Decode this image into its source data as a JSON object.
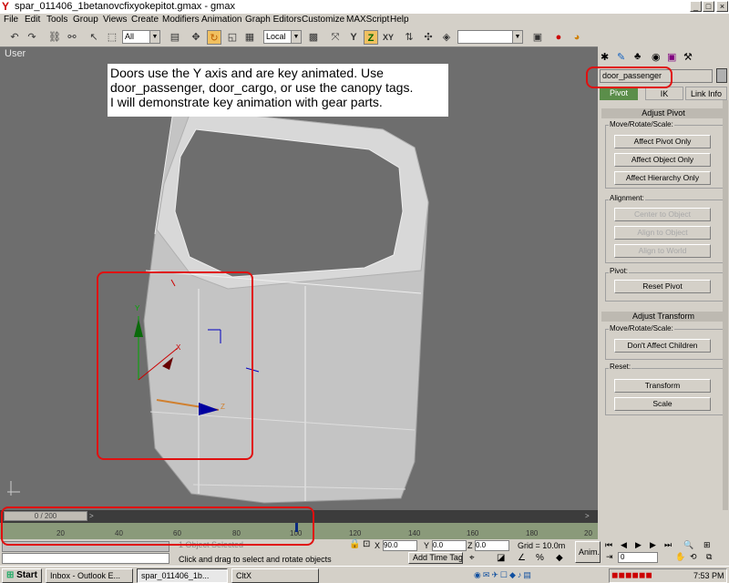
{
  "window": {
    "title": "spar_011406_1betanovcfixyokepitot.gmax - gmax",
    "min": "_",
    "max": "□",
    "close": "×"
  },
  "menu": [
    "File",
    "Edit",
    "Tools",
    "Group",
    "Views",
    "Create",
    "Modifiers",
    "Animation",
    "Graph Editors",
    "Customize",
    "MAXScript",
    "Help"
  ],
  "toolbar": {
    "filter": "All",
    "coord": "Local",
    "axis_z": "Z",
    "axis_y": "Y",
    "axis_x": "X",
    "axis_xy": "XY"
  },
  "viewport": {
    "label": "User"
  },
  "annotation": {
    "line1": "Doors use the Y axis and are key animated.  Use",
    "line2": "door_passenger, door_cargo, or use the canopy tags.",
    "line3": " I will demonstrate key animation with gear parts."
  },
  "gizmo": {
    "y": "Y",
    "x": "X",
    "z": "Z"
  },
  "command_panel": {
    "object_name": "door_passenger",
    "tabs": {
      "pivot": "Pivot",
      "ik": "IK",
      "link": "Link Info"
    },
    "adjust_pivot": "Adjust Pivot",
    "move_rotate_scale": "Move/Rotate/Scale:",
    "affect_pivot": "Affect Pivot Only",
    "affect_object": "Affect Object Only",
    "affect_hierarchy": "Affect Hierarchy Only",
    "alignment": "Alignment:",
    "center_to_object": "Center to Object",
    "align_to_object": "Align to Object",
    "align_to_world": "Align to World",
    "pivot": "Pivot:",
    "reset_pivot": "Reset Pivot",
    "adjust_transform": "Adjust Transform",
    "move_rotate_scale2": "Move/Rotate/Scale:",
    "dont_affect_children": "Don't Affect Children",
    "reset": "Reset:",
    "transform": "Transform",
    "scale": "Scale"
  },
  "timeline": {
    "slider": "0 / 200",
    "ticks": [
      "20",
      "40",
      "60",
      "80",
      "100",
      "120",
      "140",
      "160",
      "180",
      "20"
    ]
  },
  "status": {
    "selected": "1 Object Selected",
    "prompt": "Click and drag to select and rotate objects",
    "x_label": "X",
    "x_val": "90.0",
    "y_label": "Y",
    "y_val": "0.0",
    "z_label": "Z",
    "z_val": "0.0",
    "grid": "Grid = 10.0m",
    "add_time_tag": "Add Time Tag",
    "anim": "Anim.",
    "frame": "0"
  },
  "taskbar": {
    "start": "Start",
    "task1": "Inbox - Outlook E...",
    "task2": "spar_011406_1b...",
    "task3": "CltX",
    "clock": "7:53 PM"
  }
}
